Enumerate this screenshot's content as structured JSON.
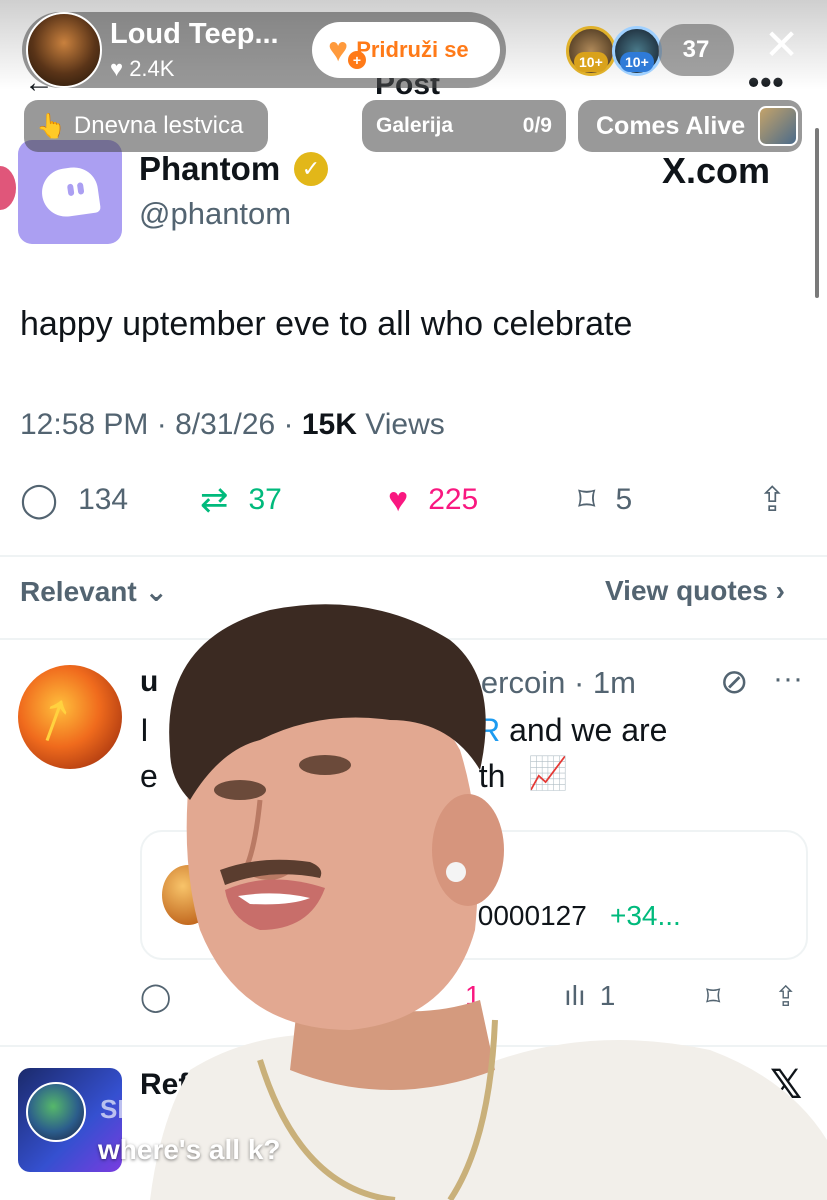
{
  "live": {
    "host_name": "Loud Teep...",
    "host_likes": "2.4K",
    "join_label": "Pridruži se",
    "viewer_badges": [
      "10+",
      "10+"
    ],
    "viewer_count": "37",
    "rank_chip": "Dnevna lestvica",
    "gallery_label": "Galerija",
    "gallery_count": "0/9",
    "comes_alive_label": "Comes Alive",
    "comment": {
      "user": "SKI Z",
      "text": "where's all k?"
    }
  },
  "post": {
    "header_title": "Post",
    "author_name": "Phantom",
    "author_handle": "@phantom",
    "site_label": "X.com",
    "text": "happy uptember eve to all who celebrate",
    "time": "12:58 PM",
    "date": "8/31/26",
    "views_count": "15K",
    "views_label": "Views",
    "replies": "134",
    "reposts": "37",
    "likes": "225",
    "bookmarks": "5",
    "sort_label": "Relevant",
    "view_quotes_label": "View quotes",
    "reply": {
      "name": "u",
      "handle_time": "tembercoin · 1m",
      "line1_prefix": "I",
      "line1_link": "MBER",
      "line1_suffix": " and we are",
      "line2": "e",
      "line2_end": "th",
      "price": ".0000127",
      "price_change": "+34...",
      "likes": "1",
      "views": "1"
    },
    "next_reply_name": "Ref"
  },
  "colors": {
    "phantom_purple": "#ab9ff2",
    "like_pink": "#f91880",
    "repost_green": "#00ba7c",
    "link_blue": "#1d9bf0",
    "join_orange": "#ff7a18"
  }
}
